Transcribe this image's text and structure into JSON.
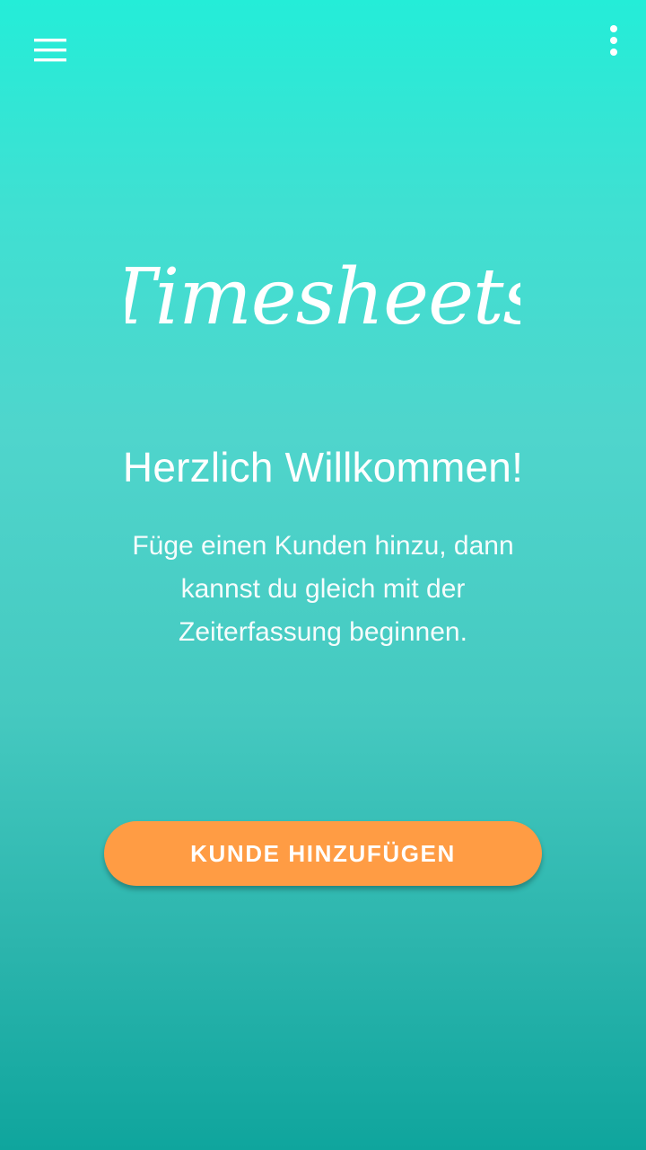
{
  "toolbar": {
    "menu_icon": "hamburger-menu-icon",
    "more_icon": "more-vert-icon"
  },
  "logo": {
    "text": "Timesheets"
  },
  "welcome": {
    "title": "Herzlich Willkommen!",
    "text": "Füge einen Kunden hinzu, dann kannst du gleich mit der Zeiterfassung beginnen."
  },
  "actions": {
    "add_customer_label": "KUNDE HINZUFÜGEN"
  },
  "colors": {
    "gradient_top": "#24EDD8",
    "gradient_bottom": "#0FA59D",
    "accent_button": "#FF9C44",
    "text": "#FFFFFF"
  }
}
